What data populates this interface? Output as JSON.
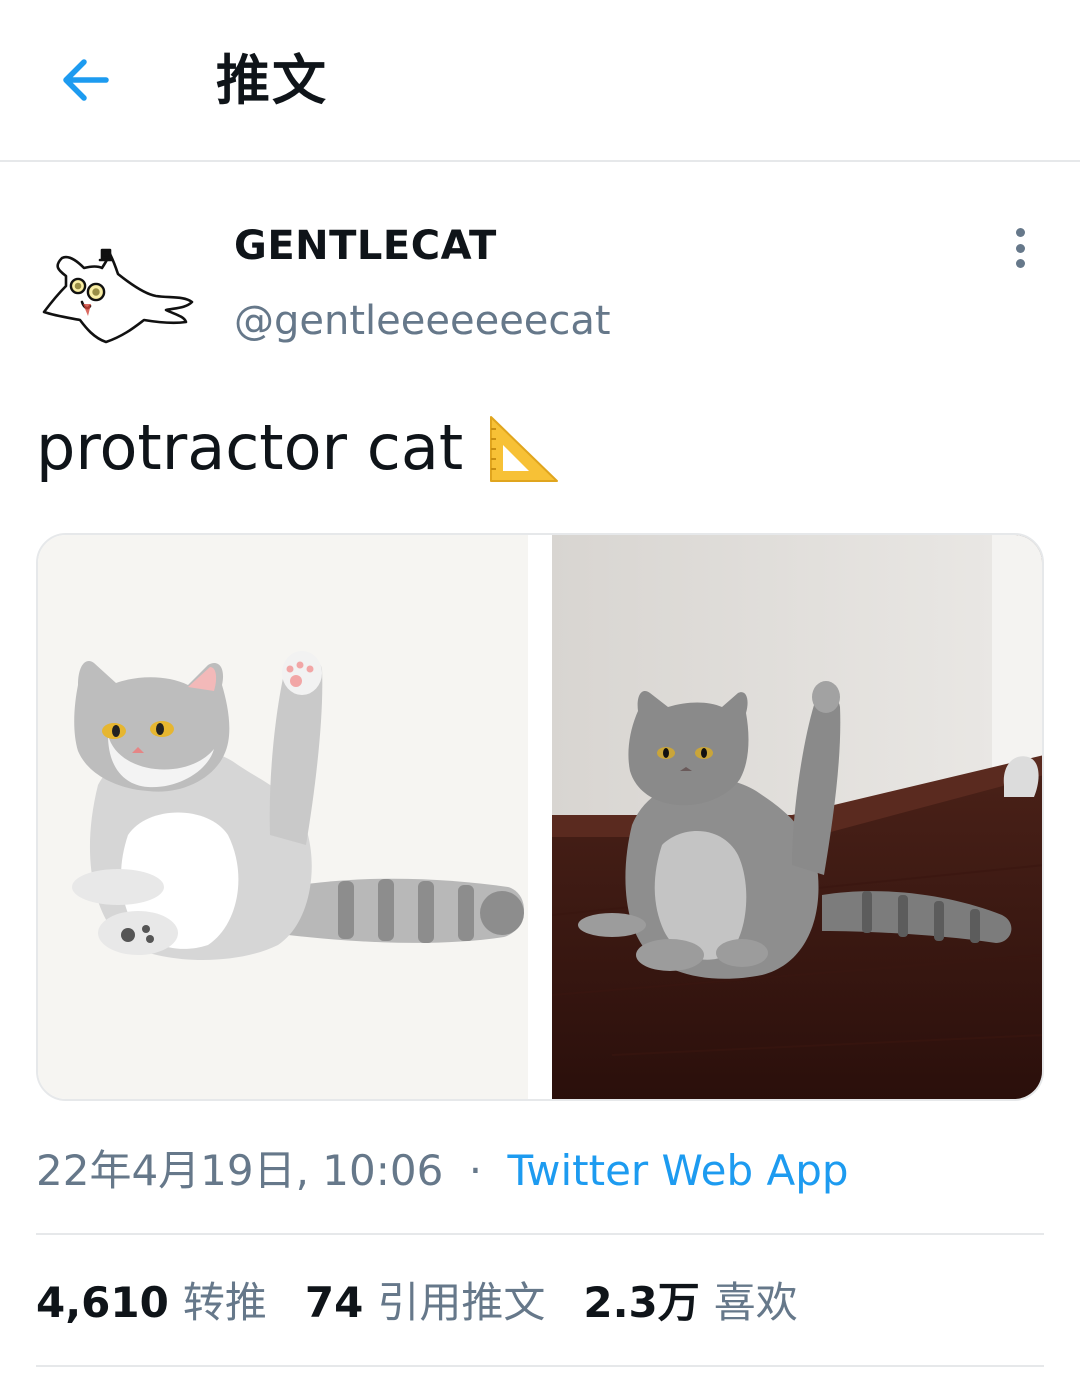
{
  "header": {
    "back_icon": "arrow-left-icon",
    "title": "推文"
  },
  "tweet": {
    "display_name": "GENTLECAT",
    "handle": "@gentleeeeeeecat",
    "text": "protractor cat",
    "emoji": "triangular-ruler-emoji",
    "timestamp": "22年4月19日, 10:06",
    "separator": "·",
    "source": "Twitter Web App"
  },
  "stats": [
    {
      "count": "4,610",
      "label": "转推"
    },
    {
      "count": "74",
      "label": "引用推文"
    },
    {
      "count": "2.3万",
      "label": "喜欢"
    }
  ],
  "colors": {
    "accent": "#1d9bf0",
    "text_primary": "#0f1419",
    "text_secondary": "#66788a",
    "divider": "#e6e8ea"
  }
}
